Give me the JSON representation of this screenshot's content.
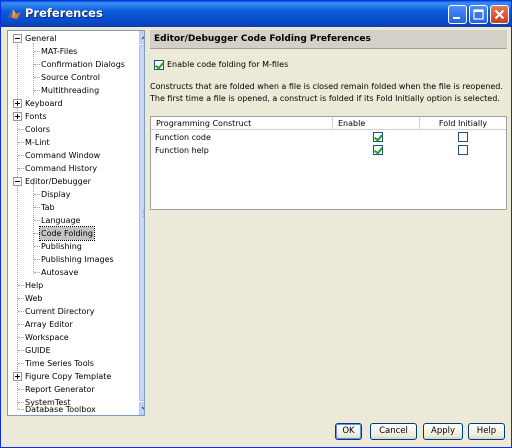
{
  "window": {
    "title": "Preferences",
    "icon": "matlab-logo-icon"
  },
  "titlebar_buttons": [
    "minimize-icon",
    "maximize-icon",
    "close-icon"
  ],
  "tree": {
    "items": [
      {
        "label": "General",
        "level": 0,
        "toggle": "minus"
      },
      {
        "label": "MAT-Files",
        "level": 1
      },
      {
        "label": "Confirmation Dialogs",
        "level": 1
      },
      {
        "label": "Source Control",
        "level": 1
      },
      {
        "label": "Multithreading",
        "level": 1
      },
      {
        "label": "Keyboard",
        "level": 0,
        "toggle": "plus"
      },
      {
        "label": "Fonts",
        "level": 0,
        "toggle": "plus"
      },
      {
        "label": "Colors",
        "level": 0
      },
      {
        "label": "M-Lint",
        "level": 0
      },
      {
        "label": "Command Window",
        "level": 0
      },
      {
        "label": "Command History",
        "level": 0
      },
      {
        "label": "Editor/Debugger",
        "level": 0,
        "toggle": "minus"
      },
      {
        "label": "Display",
        "level": 1
      },
      {
        "label": "Tab",
        "level": 1
      },
      {
        "label": "Language",
        "level": 1
      },
      {
        "label": "Code Folding",
        "level": 1,
        "selected": true
      },
      {
        "label": "Publishing",
        "level": 1
      },
      {
        "label": "Publishing Images",
        "level": 1
      },
      {
        "label": "Autosave",
        "level": 1
      },
      {
        "label": "Help",
        "level": 0
      },
      {
        "label": "Web",
        "level": 0
      },
      {
        "label": "Current Directory",
        "level": 0
      },
      {
        "label": "Array Editor",
        "level": 0
      },
      {
        "label": "Workspace",
        "level": 0
      },
      {
        "label": "GUIDE",
        "level": 0
      },
      {
        "label": "Time Series Tools",
        "level": 0
      },
      {
        "label": "Figure Copy Template",
        "level": 0,
        "toggle": "plus"
      },
      {
        "label": "Report Generator",
        "level": 0
      },
      {
        "label": "SystemTest",
        "level": 0
      },
      {
        "label": "Database Toolbox",
        "level": 0
      }
    ]
  },
  "panel": {
    "title": "Editor/Debugger Code Folding Preferences",
    "enable_folding_label": "Enable code folding for M-files",
    "enable_folding_checked": true,
    "description_line1": "Constructs that are folded when a file is closed remain folded when the file is reopened.",
    "description_line2": "The first time a file is opened, a construct is folded if its Fold Initially option is selected.",
    "table": {
      "columns": [
        "Programming Construct",
        "Enable",
        "Fold Initially"
      ],
      "rows": [
        {
          "construct": "Function code",
          "enable": true,
          "fold_initially": false
        },
        {
          "construct": "Function help",
          "enable": true,
          "fold_initially": false
        }
      ]
    }
  },
  "buttons": {
    "ok": "OK",
    "cancel": "Cancel",
    "apply": "Apply",
    "help": "Help"
  }
}
